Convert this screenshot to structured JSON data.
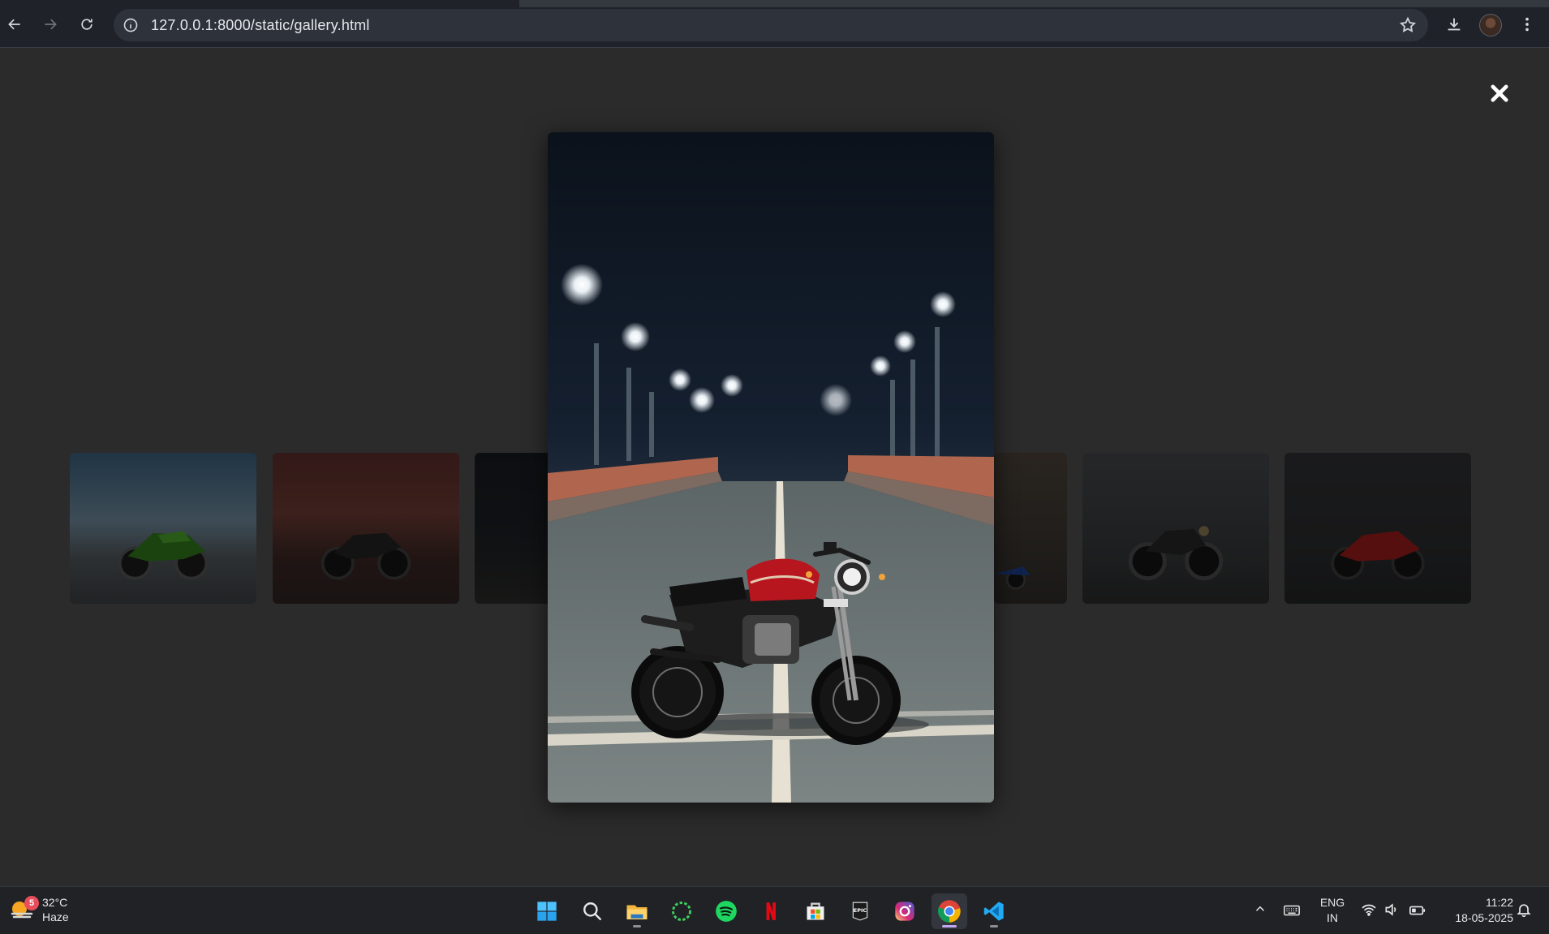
{
  "browser": {
    "url": "127.0.0.1:8000/static/gallery.html",
    "icons": [
      "back-arrow-icon",
      "forward-arrow-icon",
      "reload-icon",
      "site-info-icon",
      "bookmark-star-icon",
      "download-icon",
      "profile-avatar",
      "more-vert-icon"
    ]
  },
  "gallery": {
    "thumbnails": [
      {
        "name": "green sport bike"
      },
      {
        "name": "naked bike red wall"
      },
      {
        "name": "dark street bike"
      },
      {
        "name": "blue sport bike"
      },
      {
        "name": "scrambler bike"
      },
      {
        "name": "red superbike"
      }
    ],
    "close_icon": "close-icon",
    "lightbox_image": "cafe-racer motorcycle on night bridge"
  },
  "taskbar": {
    "weather": {
      "temp": "32°C",
      "condition": "Haze",
      "badge": "5"
    },
    "apps": [
      "windows-start-icon",
      "search-icon",
      "file-explorer-icon",
      "spinner-app-icon",
      "spotify-icon",
      "netflix-icon",
      "microsoft-store-icon",
      "epic-games-icon",
      "instagram-icon",
      "chrome-icon",
      "vscode-icon"
    ],
    "tray": {
      "lang_line1": "ENG",
      "lang_line2": "IN",
      "time": "11:22",
      "date": "18-05-2025"
    },
    "colors": {
      "active_indicator": "#c2a8f0"
    }
  }
}
